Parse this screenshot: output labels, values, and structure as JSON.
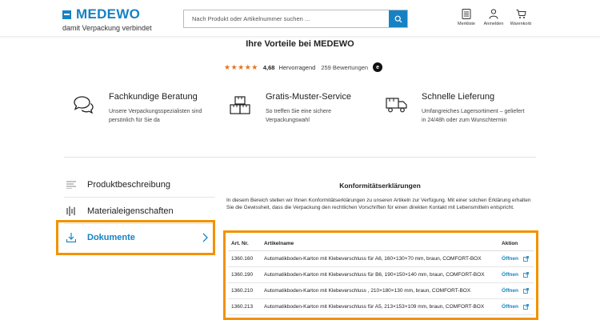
{
  "header": {
    "logo_text": "MEDEWO",
    "slogan": "damit Verpackung verbindet",
    "search_placeholder": "Nach Produkt oder Artikelnummer suchen ...",
    "icons": [
      {
        "name": "merkliste-icon",
        "label": "Merkliste"
      },
      {
        "name": "user-icon",
        "label": "Anmelden"
      },
      {
        "name": "cart-icon",
        "label": "Warenkorb"
      }
    ]
  },
  "benefits": {
    "title": "Ihre Vorteile bei MEDEWO",
    "rating": {
      "stars": "★★★★★",
      "score": "4,68",
      "label": "Hervorragend",
      "count": "259 Bewertungen",
      "badge": "e"
    },
    "items": [
      {
        "title": "Fachkundige Beratung",
        "text": "Unsere Verpackungsspezialisten sind persönlich für Sie da",
        "icon": "chat-bubbles-icon"
      },
      {
        "title": "Gratis-Muster-Service",
        "text": "So treffen Sie eine sichere Verpackungswahl",
        "icon": "boxes-icon"
      },
      {
        "title": "Schnelle Lieferung",
        "text": "Umfangreiches Lagersortiment – geliefert in 24/48h oder zum Wunschtermin",
        "icon": "truck-icon"
      }
    ]
  },
  "tabs": [
    {
      "label": "Produktbeschreibung",
      "icon": "lines-icon"
    },
    {
      "label": "Materialeigenschaften",
      "icon": "material-icon"
    },
    {
      "label": "Dokumente",
      "icon": "download-icon"
    }
  ],
  "content": {
    "title": "Konformitätserklärungen",
    "text": "In diesem Bereich stellen wir Ihnen Konformitätserklärungen zu unseren Artikeln zur Verfügung. Mit einer solchen Erklärung erhalten Sie die Gewissheit, dass die Verpackung den rechtlichen Vorschriften für einen direkten Kontakt mit Lebensmitteln entspricht.",
    "columns": [
      "Art. Nr.",
      "Artikelname",
      "Aktion"
    ],
    "rows": [
      {
        "nr": "1360.160",
        "name": "Automatikboden-Karton mit Klebeverschluss für A6, 160×130×70 mm, braun, COMFORT-BOX",
        "action": "Öffnen"
      },
      {
        "nr": "1360.190",
        "name": "Automatikboden-Karton mit Klebeverschluss für B6, 190×150×140 mm, braun, COMFORT-BOX",
        "action": "Öffnen"
      },
      {
        "nr": "1360.210",
        "name": "Automatikboden-Karton mit Klebeverschluss , 210×180×130 mm, braun, COMFORT-BOX",
        "action": "Öffnen"
      },
      {
        "nr": "1360.213",
        "name": "Automatikboden-Karton mit Klebeverschluss für A5, 213×153×109 mm, braun, COMFORT-BOX",
        "action": "Öffnen"
      }
    ]
  },
  "colors": {
    "brand": "#1682c4",
    "highlight": "#f39200",
    "star": "#e8731a"
  }
}
